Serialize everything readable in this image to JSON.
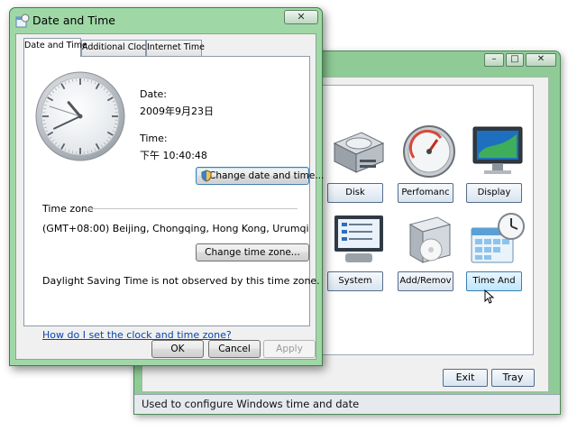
{
  "background_window": {
    "buttons": {
      "minimize": "–",
      "maximize": "□",
      "close": "✕"
    },
    "apps": [
      {
        "label": "Disk",
        "icon": "disk-icon"
      },
      {
        "label": "Perfomanc",
        "icon": "performance-gauge-icon"
      },
      {
        "label": "Display",
        "icon": "display-monitor-icon"
      },
      {
        "label": "System",
        "icon": "system-checklist-icon"
      },
      {
        "label": "Add/Remov",
        "icon": "add-remove-programs-icon"
      },
      {
        "label": "Time And",
        "icon": "calendar-clock-icon"
      }
    ],
    "exit_label": "Exit",
    "tray_label": "Tray",
    "status_text": "Used to configure Windows time and date"
  },
  "dialog": {
    "title": "Date and Time",
    "close_label": "✕",
    "tabs": [
      "Date and Time",
      "Additional Clocks",
      "Internet Time"
    ],
    "active_tab": 0,
    "date_label": "Date:",
    "date_value": "2009年9月23日",
    "time_label": "Time:",
    "time_value": "下午 10:40:48",
    "change_date_button": "Change date and time...",
    "timezone_heading": "Time zone",
    "timezone_value": "(GMT+08:00) Beijing, Chongqing, Hong Kong, Urumqi",
    "change_timezone_button": "Change time zone...",
    "dst_note": "Daylight Saving Time is not observed by this time zone.",
    "help_link": "How do I set the clock and time zone?",
    "ok_label": "OK",
    "cancel_label": "Cancel",
    "apply_label": "Apply",
    "clock": {
      "hour": 10,
      "minute": 40,
      "second": 48
    }
  },
  "colors": {
    "titlebar_green": "#9fd8a6",
    "link_blue": "#0645ad"
  }
}
